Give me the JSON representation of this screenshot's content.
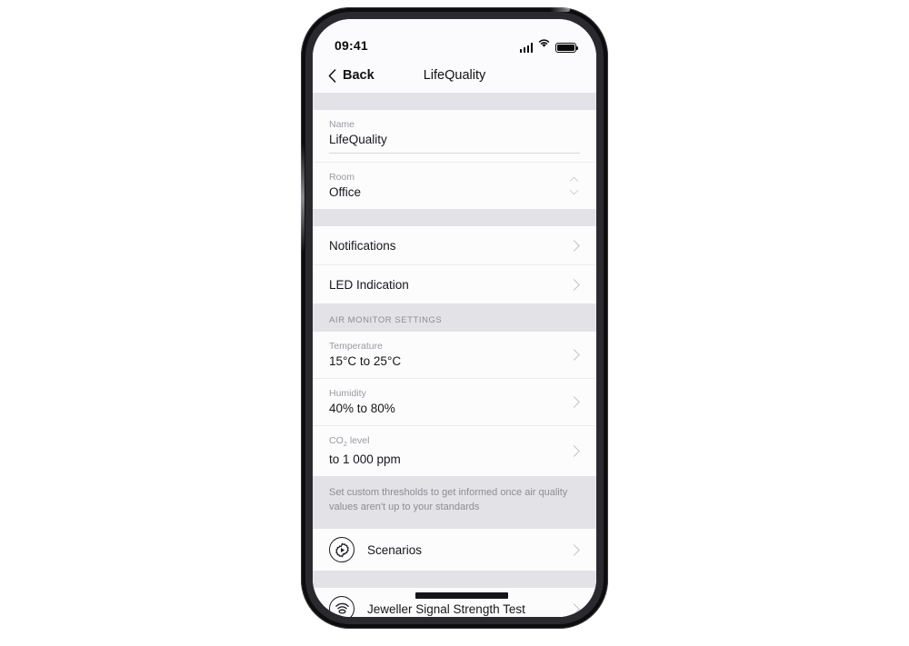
{
  "status_bar": {
    "time": "09:41",
    "signal_icon": "cellular-signal-icon",
    "wifi_icon": "wifi-icon",
    "battery_icon": "battery-full-icon"
  },
  "nav": {
    "back_label": "Back",
    "back_icon": "chevron-left-icon",
    "title": "LifeQuality"
  },
  "fields": [
    {
      "label": "Name",
      "value": "LifeQuality"
    },
    {
      "label": "Room",
      "value": "Office"
    }
  ],
  "menu_rows": [
    {
      "label": "Notifications"
    },
    {
      "label": "LED Indication"
    }
  ],
  "air_monitor": {
    "section_title": "AIR MONITOR SETTINGS",
    "rows": [
      {
        "label": "Temperature",
        "value": "15°C to 25°C"
      },
      {
        "label_prefix": "CO",
        "label": "Humidity",
        "value": "40% to 80%"
      },
      {
        "label": "CO2 level",
        "value": "to 1 000 ppm"
      }
    ],
    "co2_label_main": "CO",
    "co2_label_sub": "2",
    "co2_label_tail": " level",
    "footer_note": "Set custom thresholds to get informed once air quality values aren't up to your standards"
  },
  "action_rows": [
    {
      "label": "Scenarios",
      "icon": "gear-play-icon"
    }
  ],
  "bottom_row": {
    "label": "Jeweller Signal Strength Test",
    "icon": "signal-waves-icon"
  },
  "colors": {
    "screen_bg": "#fcfcfd",
    "band_gray": "#e3e2e6",
    "text_primary": "#17171b",
    "text_secondary": "#9a9aa0",
    "chevron": "#c3c1c7",
    "page_bg": "#ffffff"
  }
}
